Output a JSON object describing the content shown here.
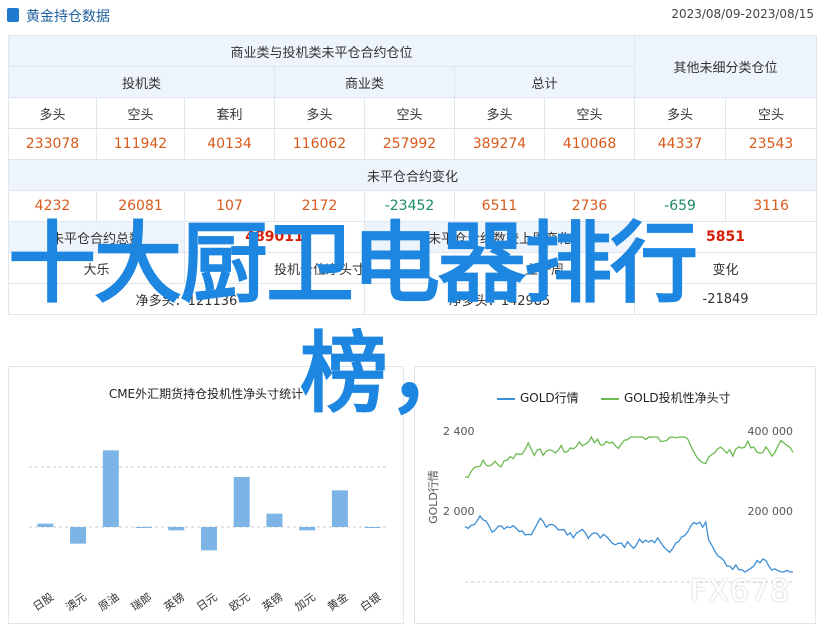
{
  "header": {
    "title": "黄金持仓数据",
    "date_range": "2023/08/09-2023/08/15"
  },
  "table": {
    "group_main": "商业类与投机类未平仓合约仓位",
    "group_other": "其他未细分类仓位",
    "sub_groups": [
      "投机类",
      "商业类",
      "总计"
    ],
    "col_labels": [
      "多头",
      "空头",
      "套利",
      "多头",
      "空头",
      "多头",
      "空头",
      "多头",
      "空头"
    ],
    "values": [
      "233078",
      "111942",
      "40134",
      "116062",
      "257992",
      "389274",
      "410068",
      "44337",
      "23543"
    ],
    "change_title": "未平仓合约变化",
    "changes": [
      "4232",
      "26081",
      "107",
      "2172",
      "-23452",
      "6511",
      "2736",
      "-659",
      "3116"
    ],
    "total_label": "未平仓合约总数",
    "total_value": "489011",
    "compare_label": "未平仓合约数较上周变化",
    "compare_value": "5851",
    "spec_net_label": "投机仓位净头寸",
    "spec_net_short": "大乐",
    "up_label": "上一周",
    "down_label": "变化",
    "net_long_1": "净多头：121136",
    "net_long_2": "净多头：142985",
    "net_change": "-21849"
  },
  "overlay": {
    "line1": "十大厨卫电器排行",
    "line2": "榜，"
  },
  "chart_data": [
    {
      "type": "bar",
      "title": "CME外汇期货持仓投机性净头寸统计",
      "categories": [
        "日股",
        "澳元",
        "原油",
        "瑞郎",
        "英镑",
        "日元",
        "欧元",
        "英镑",
        "加元",
        "黄金",
        "白银"
      ],
      "values": [
        0.1,
        -0.5,
        2.3,
        0.0,
        -0.1,
        -0.7,
        1.5,
        0.4,
        -0.1,
        1.1,
        0.0
      ],
      "ylim": [
        -1.8,
        3.0
      ]
    },
    {
      "type": "line",
      "series": [
        {
          "name": "GOLD行情",
          "color": "#3d8fd6"
        },
        {
          "name": "GOLD投机性净头寸",
          "color": "#6dbb52"
        }
      ],
      "left_axis_label": "GOLD行情",
      "left_ticks": [
        "2 400",
        "2 000"
      ],
      "right_ticks": [
        "400 000",
        "200 000"
      ]
    }
  ],
  "watermark": "FX678",
  "colors": {
    "accent": "#1f7ad0",
    "up": "#d85a1a",
    "down": "#1a8a6a",
    "bar": "#7db4e6"
  }
}
